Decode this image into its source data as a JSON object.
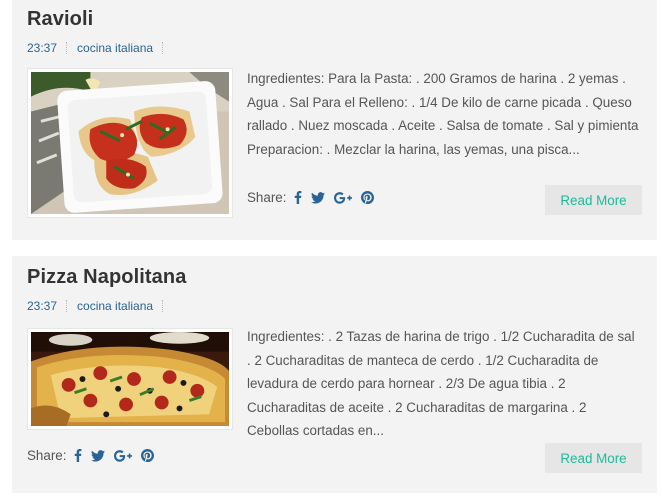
{
  "posts": [
    {
      "title": "Ravioli",
      "time": "23:37",
      "category": "cocina italiana",
      "excerpt": "Ingredientes: Para la Pasta: . 200 Gramos de harina . 2 yemas . Agua . Sal Para el Relleno: . 1/4 De kilo de carne picada . Queso rallado . Nuez moscada . Aceite . Salsa de tomate . Sal y pimienta Preparacion: . Mezclar la harina, las yemas, una pisca...",
      "share_label": "Share:",
      "read_more": "Read More"
    },
    {
      "title": "Pizza Napolitana",
      "time": "23:37",
      "category": "cocina italiana",
      "excerpt": "Ingredientes: . 2 Tazas de harina de trigo . 1/2 Cucharadita de sal . 2 Cucharaditas de manteca de cerdo . 1/2 Cucharadita de levadura de cerdo para hornear . 2/3 De agua tibia  . 2 Cucharaditas de aceite . 2 Cucharaditas de margarina . 2 Cebollas cortadas en...",
      "share_label": "Share:",
      "read_more": "Read More"
    }
  ],
  "icons": {
    "share": [
      "facebook-icon",
      "twitter-icon",
      "google-plus-icon",
      "pinterest-icon"
    ]
  },
  "colors": {
    "card_bg": "#f3f3f3",
    "title": "#333333",
    "link": "#2a6496",
    "read_more_text": "#1abc9c",
    "read_more_bg": "#e6e6e6"
  }
}
